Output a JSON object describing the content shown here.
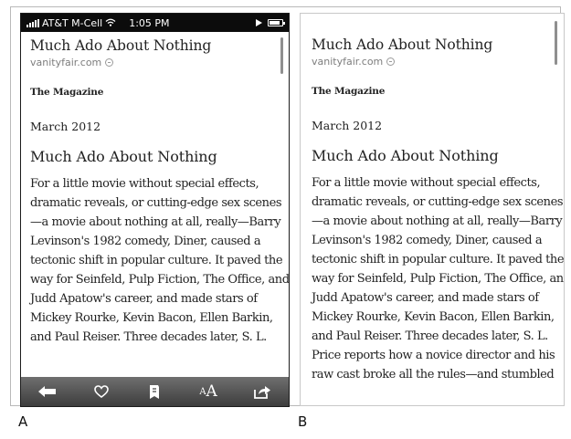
{
  "panel_a": {
    "status_bar": {
      "carrier": "AT&T M-Cell",
      "time": "1:05 PM"
    },
    "page_title": "Much Ado About Nothing",
    "source": "vanityfair.com",
    "section": "The Magazine",
    "issue_date": "March 2012",
    "article_title": "Much Ado About Nothing",
    "body_lines": [
      "For a little movie without special effects,",
      "dramatic reveals, or cutting-edge sex scenes",
      "—a movie about nothing at all, really—Barry",
      "Levinson's 1982 comedy, Diner, caused a",
      "tectonic shift in popular culture. It paved the",
      "way for Seinfeld, Pulp Fiction, The Office, and",
      "Judd Apatow's career, and made stars of",
      "Mickey Rourke, Kevin Bacon, Ellen Barkin,",
      "and Paul Reiser. Three decades later, S. L."
    ],
    "toolbar": {
      "back_icon": "back-arrow-icon",
      "favorite_icon": "heart-icon",
      "save_icon": "save-icon",
      "text_size_small": "A",
      "text_size_large": "A",
      "share_icon": "share-icon"
    }
  },
  "panel_b": {
    "page_title": "Much Ado About Nothing",
    "source": "vanityfair.com",
    "section": "The Magazine",
    "issue_date": "March 2012",
    "article_title": "Much Ado About Nothing",
    "body_lines": [
      "For a little movie without special effects,",
      "dramatic reveals, or cutting-edge sex scenes",
      "—a movie about nothing at all, really—Barry",
      "Levinson's 1982 comedy, Diner, caused a",
      "tectonic shift in popular culture. It paved the",
      "way for Seinfeld, Pulp Fiction, The Office, and",
      "Judd Apatow's career, and made stars of",
      "Mickey Rourke, Kevin Bacon, Ellen Barkin,",
      "and Paul Reiser. Three decades later, S. L.",
      "Price reports how a novice director and his",
      "raw cast broke all the rules—and stumbled"
    ]
  },
  "captions": {
    "a": "A",
    "b": "B"
  },
  "colors": {
    "status_bar": "#0c0c0c",
    "toolbar": "#4e4e4e",
    "source_text": "#7d7d7d"
  }
}
